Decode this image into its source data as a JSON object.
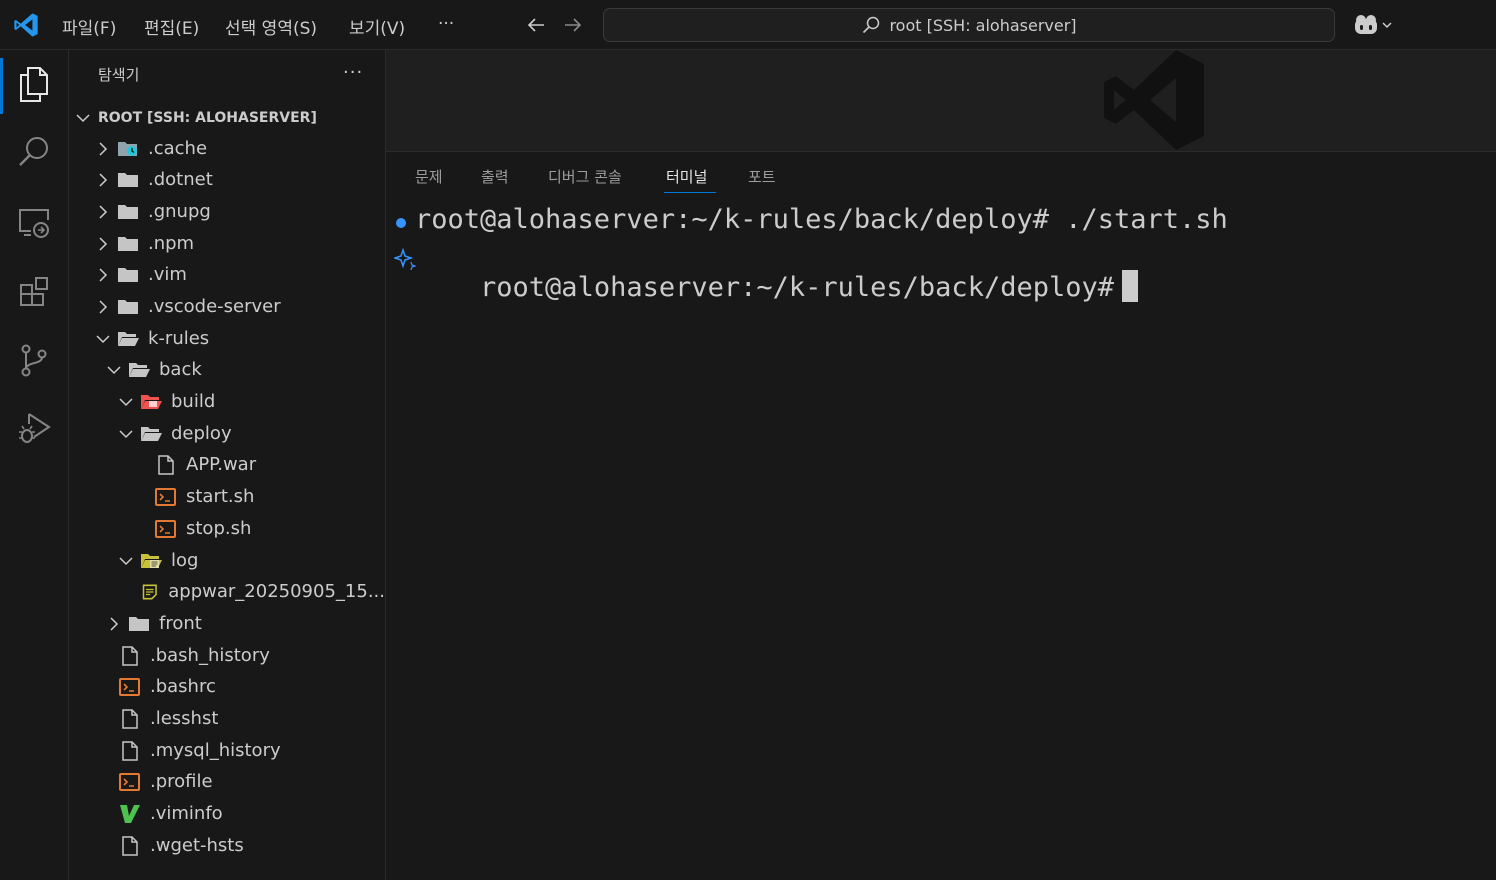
{
  "titlebar": {
    "menu": [
      "파일(F)",
      "편집(E)",
      "선택 영역(S)",
      "보기(V)",
      "···"
    ],
    "command_center": "root [SSH: alohaserver]"
  },
  "sidebar": {
    "title": "탐색기",
    "more": "···",
    "root_label": "ROOT [SSH: ALOHASERVER]",
    "tree": [
      {
        "label": ".cache"
      },
      {
        "label": ".dotnet"
      },
      {
        "label": ".gnupg"
      },
      {
        "label": ".npm"
      },
      {
        "label": ".vim"
      },
      {
        "label": ".vscode-server"
      },
      {
        "label": "k-rules"
      },
      {
        "label": "back"
      },
      {
        "label": "build"
      },
      {
        "label": "deploy"
      },
      {
        "label": "APP.war"
      },
      {
        "label": "start.sh"
      },
      {
        "label": "stop.sh"
      },
      {
        "label": "log"
      },
      {
        "label": "appwar_20250905_15..."
      },
      {
        "label": "front"
      },
      {
        "label": ".bash_history"
      },
      {
        "label": ".bashrc"
      },
      {
        "label": ".lesshst"
      },
      {
        "label": ".mysql_history"
      },
      {
        "label": ".profile"
      },
      {
        "label": ".viminfo"
      },
      {
        "label": ".wget-hsts"
      }
    ]
  },
  "panel": {
    "tabs": [
      "문제",
      "출력",
      "디버그 콘솔",
      "터미널",
      "포트"
    ],
    "active_tab": "터미널"
  },
  "terminal": {
    "lines": [
      "root@alohaserver:~/k-rules/back/deploy# ./start.sh",
      "root@alohaserver:~/k-rules/back/deploy#"
    ]
  },
  "colors": {
    "accent": "#0078d4",
    "background": "#181818",
    "folder": "#c5c5c5",
    "shell_file": "#e37933",
    "vim": "#4fc14f",
    "log_folder": "#c7c23a"
  }
}
